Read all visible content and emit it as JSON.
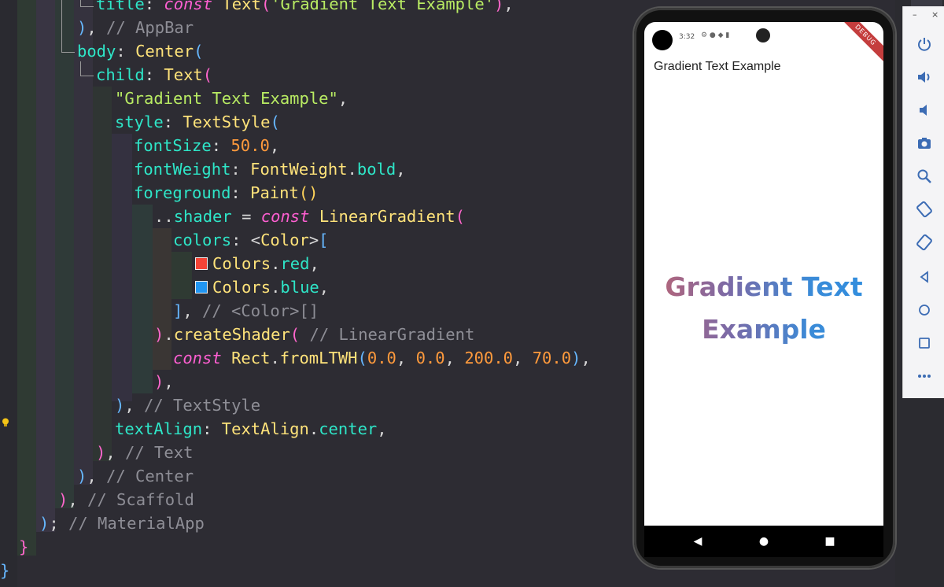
{
  "editor": {
    "lines": [
      "title: const Text('Gradient Text Example'),",
      "), // AppBar",
      "body: Center(",
      "child: Text(",
      "\"Gradient Text Example\",",
      "style: TextStyle(",
      "fontSize: 50.0,",
      "fontWeight: FontWeight.bold,",
      "foreground: Paint()",
      "..shader = const LinearGradient(",
      "colors: <Color>[",
      "Colors.red,",
      "Colors.blue,",
      "], // <Color>[]",
      ").createShader( // LinearGradient",
      "const Rect.fromLTWH(0.0, 0.0, 200.0, 70.0),",
      "),",
      "), // TextStyle",
      "textAlign: TextAlign.center,",
      "), // Text",
      "), // Center",
      "), // Scaffold",
      "); // MaterialApp",
      "}",
      "}"
    ],
    "swatches": {
      "red": "#f44336",
      "blue": "#2196f3"
    }
  },
  "phone": {
    "status_time": "3:32",
    "debug_banner": "DEBUG",
    "appbar_title": "Gradient Text Example",
    "body_text_line1": "Gradient Text",
    "body_text_line2": "Example",
    "gradient_colors": [
      "#f44336",
      "#2196f3"
    ]
  },
  "toolbar": {
    "items": [
      "power-icon",
      "volume-up-icon",
      "volume-down-icon",
      "camera-icon",
      "zoom-icon",
      "rotate-left-icon",
      "rotate-right-icon",
      "back-icon",
      "home-icon",
      "overview-icon",
      "more-icon"
    ],
    "minimize_label": "–",
    "close_label": "×"
  }
}
